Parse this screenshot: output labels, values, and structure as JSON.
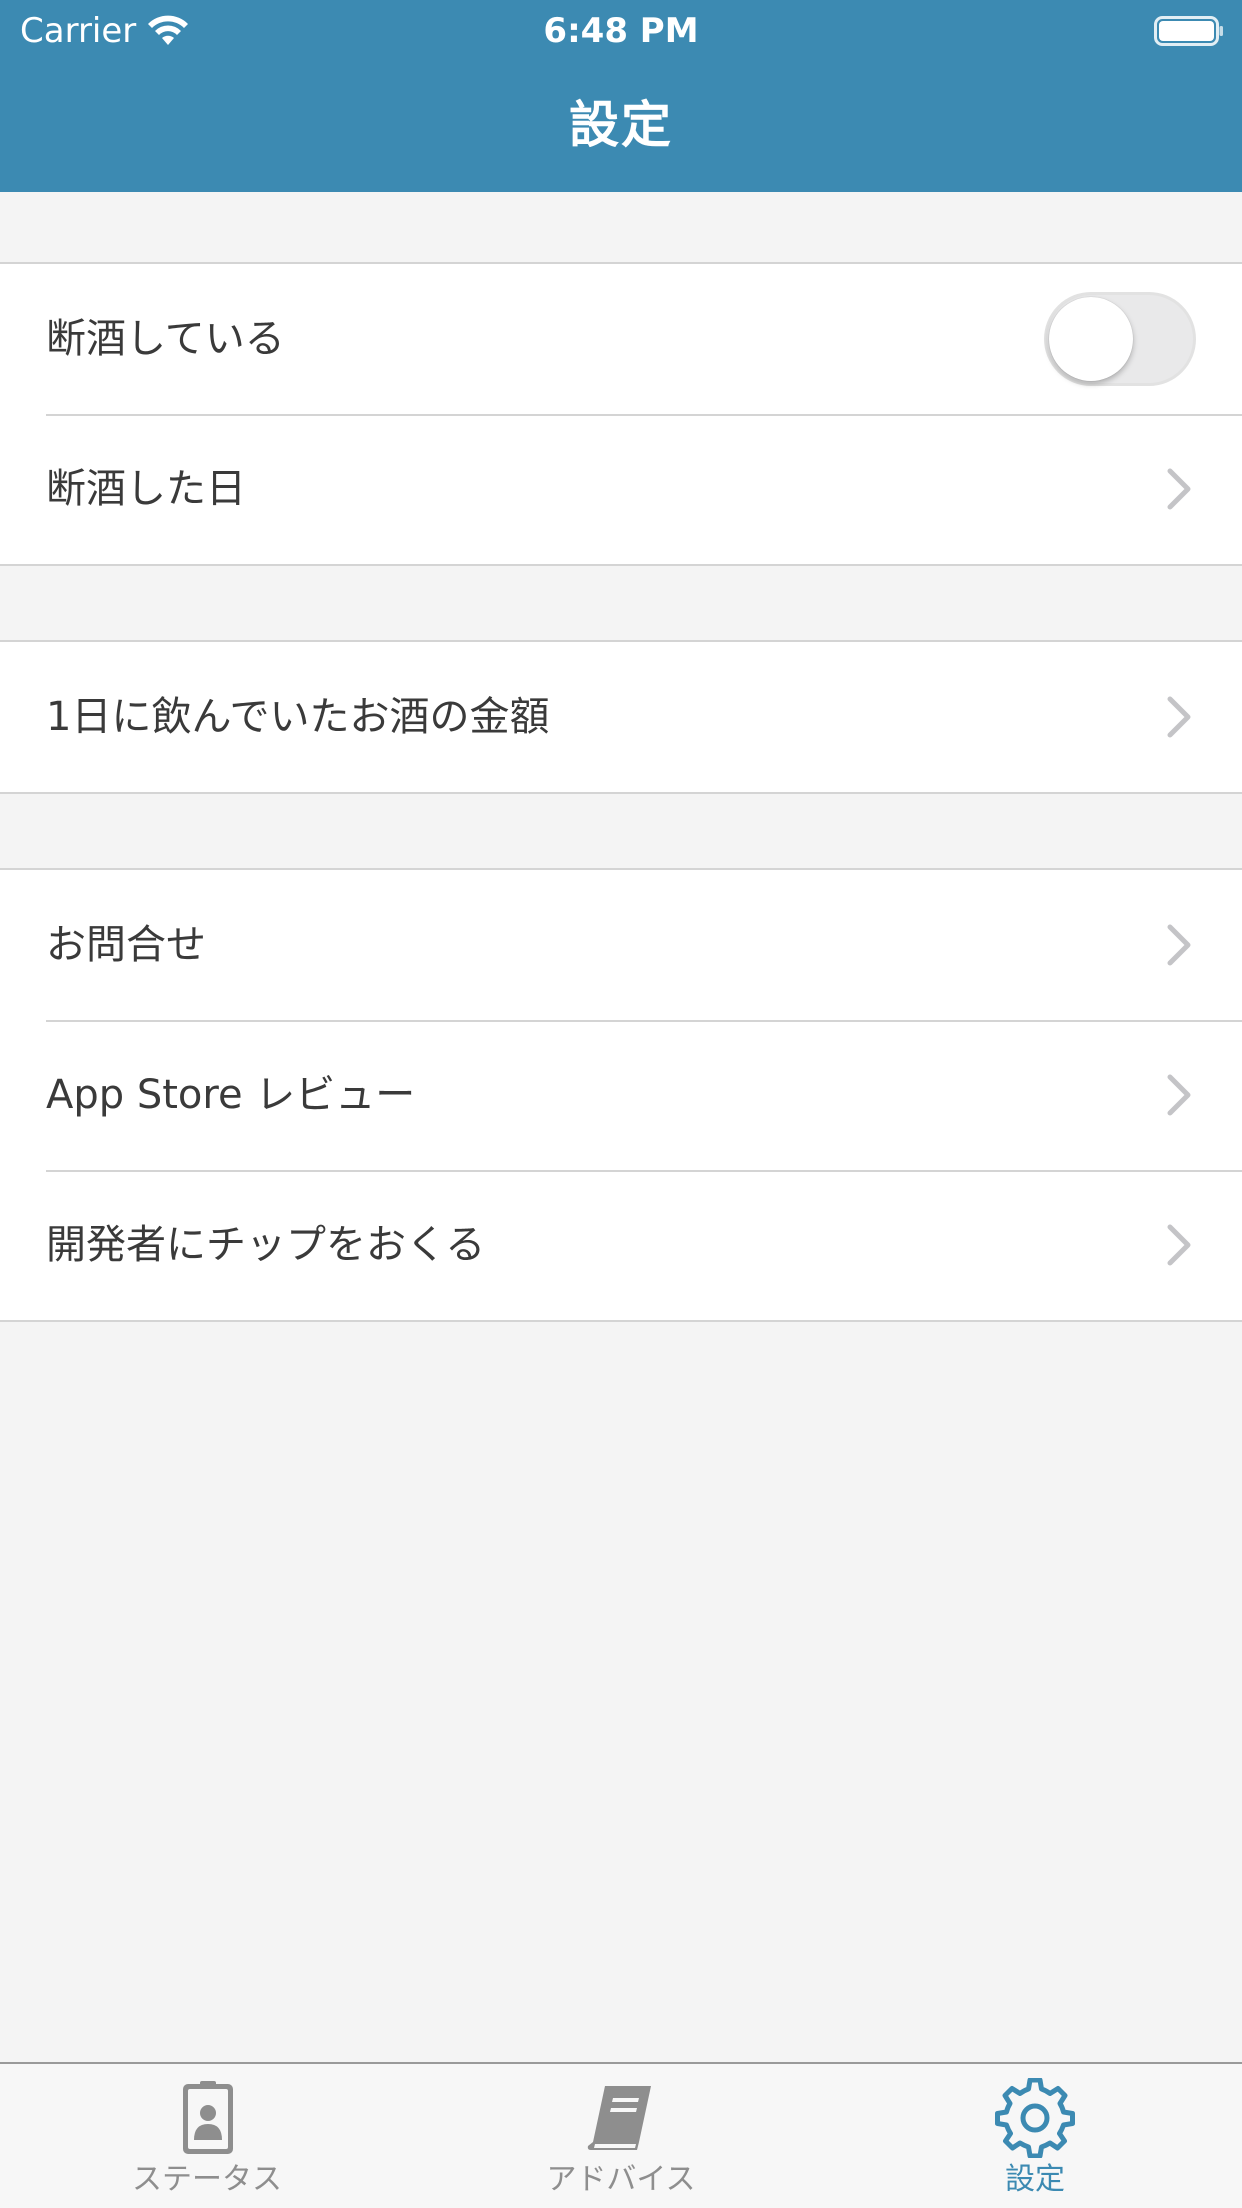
{
  "colors": {
    "header_bg": "#3c8ab2",
    "accent": "#3c8ab2",
    "inactive_tab": "#8e8e8e",
    "background": "#f4f4f4"
  },
  "status_bar": {
    "carrier": "Carrier",
    "time": "6:48 PM"
  },
  "nav": {
    "title": "設定"
  },
  "sections": [
    {
      "rows": [
        {
          "label": "断酒している",
          "accessory": "toggle",
          "toggle_on": false
        },
        {
          "label": "断酒した日",
          "accessory": "chevron"
        }
      ]
    },
    {
      "rows": [
        {
          "label": "1日に飲んでいたお酒の金額",
          "accessory": "chevron"
        }
      ]
    },
    {
      "rows": [
        {
          "label": "お問合せ",
          "accessory": "chevron"
        },
        {
          "label": "App Store レビュー",
          "accessory": "chevron"
        },
        {
          "label": "開発者にチップをおくる",
          "accessory": "chevron"
        }
      ]
    }
  ],
  "tabbar": {
    "tabs": [
      {
        "label": "ステータス",
        "icon": "id-badge-icon",
        "active": false
      },
      {
        "label": "アドバイス",
        "icon": "book-icon",
        "active": false
      },
      {
        "label": "設定",
        "icon": "gear-icon",
        "active": true
      }
    ]
  }
}
